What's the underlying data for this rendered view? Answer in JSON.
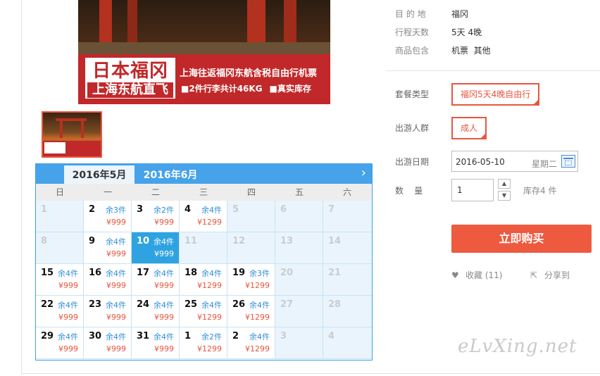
{
  "banner": {
    "logo_line1": "日本福冈",
    "logo_line2": "上海东航直飞",
    "headline": "上海往返福冈东航含税自由行机票",
    "feature1": "■2件行李共计46KG",
    "feature2": "■真实库存"
  },
  "calendar": {
    "tabs": [
      "2016年5月",
      "2016年6月"
    ],
    "next_icon": "chevron-right-icon",
    "weekdays": [
      "日",
      "一",
      "二",
      "三",
      "四",
      "五",
      "六"
    ],
    "weeks": [
      [
        {
          "day": "1",
          "stock": "",
          "price": ""
        },
        {
          "day": "2",
          "stock": "余3件",
          "price": "¥999"
        },
        {
          "day": "3",
          "stock": "余2件",
          "price": "¥999"
        },
        {
          "day": "4",
          "stock": "余4件",
          "price": "¥1299"
        },
        {
          "day": "5",
          "stock": "",
          "price": ""
        },
        {
          "day": "6",
          "stock": "",
          "price": ""
        },
        {
          "day": "7",
          "stock": "",
          "price": ""
        }
      ],
      [
        {
          "day": "8",
          "stock": "",
          "price": ""
        },
        {
          "day": "9",
          "stock": "余4件",
          "price": "¥999"
        },
        {
          "day": "10",
          "stock": "余4件",
          "price": "¥999"
        },
        {
          "day": "11",
          "stock": "",
          "price": ""
        },
        {
          "day": "12",
          "stock": "",
          "price": ""
        },
        {
          "day": "13",
          "stock": "",
          "price": ""
        },
        {
          "day": "14",
          "stock": "",
          "price": ""
        }
      ],
      [
        {
          "day": "15",
          "stock": "余4件",
          "price": "¥999"
        },
        {
          "day": "16",
          "stock": "余4件",
          "price": "¥999"
        },
        {
          "day": "17",
          "stock": "余4件",
          "price": "¥999"
        },
        {
          "day": "18",
          "stock": "余4件",
          "price": "¥1299"
        },
        {
          "day": "19",
          "stock": "余3件",
          "price": "¥1299"
        },
        {
          "day": "20",
          "stock": "",
          "price": ""
        },
        {
          "day": "21",
          "stock": "",
          "price": ""
        }
      ],
      [
        {
          "day": "22",
          "stock": "余4件",
          "price": "¥999"
        },
        {
          "day": "23",
          "stock": "余4件",
          "price": "¥999"
        },
        {
          "day": "24",
          "stock": "余4件",
          "price": "¥999"
        },
        {
          "day": "25",
          "stock": "余4件",
          "price": "¥1299"
        },
        {
          "day": "26",
          "stock": "余4件",
          "price": "¥1299"
        },
        {
          "day": "27",
          "stock": "",
          "price": ""
        },
        {
          "day": "28",
          "stock": "",
          "price": ""
        }
      ],
      [
        {
          "day": "29",
          "stock": "余4件",
          "price": "¥999"
        },
        {
          "day": "30",
          "stock": "余4件",
          "price": "¥999"
        },
        {
          "day": "31",
          "stock": "余4件",
          "price": "¥999"
        },
        {
          "day": "1",
          "stock": "余2件",
          "price": "¥1299"
        },
        {
          "day": "2",
          "stock": "余4件",
          "price": "¥1299"
        },
        {
          "day": "3",
          "stock": "",
          "price": ""
        },
        {
          "day": "4",
          "stock": "",
          "price": ""
        }
      ]
    ]
  },
  "product": {
    "destination_label": "目 的 地",
    "destination_value": "福冈",
    "duration_label": "行程天数",
    "duration_value": "5天 4晚",
    "includes_label": "商品包含",
    "includes_value": "机票  其他",
    "package_label": "套餐类型",
    "package_option": "福冈5天4晚自由行",
    "crowd_label": "出游人群",
    "crowd_option": "成人",
    "date_label": "出游日期",
    "date_value": "2016-05-10",
    "weekday_value": "星期二",
    "qty_label": "数    量",
    "qty_value": "1",
    "stock_text": "库存4 件",
    "buy_label": "立即购买",
    "favorite_label": "收藏 (11)",
    "share_label": "分享到"
  },
  "watermark": "eLvXing.net",
  "colors": {
    "accent": "#ee5a3f",
    "calendar_blue": "#46a3ea",
    "selected_day": "#2fa3e1"
  }
}
